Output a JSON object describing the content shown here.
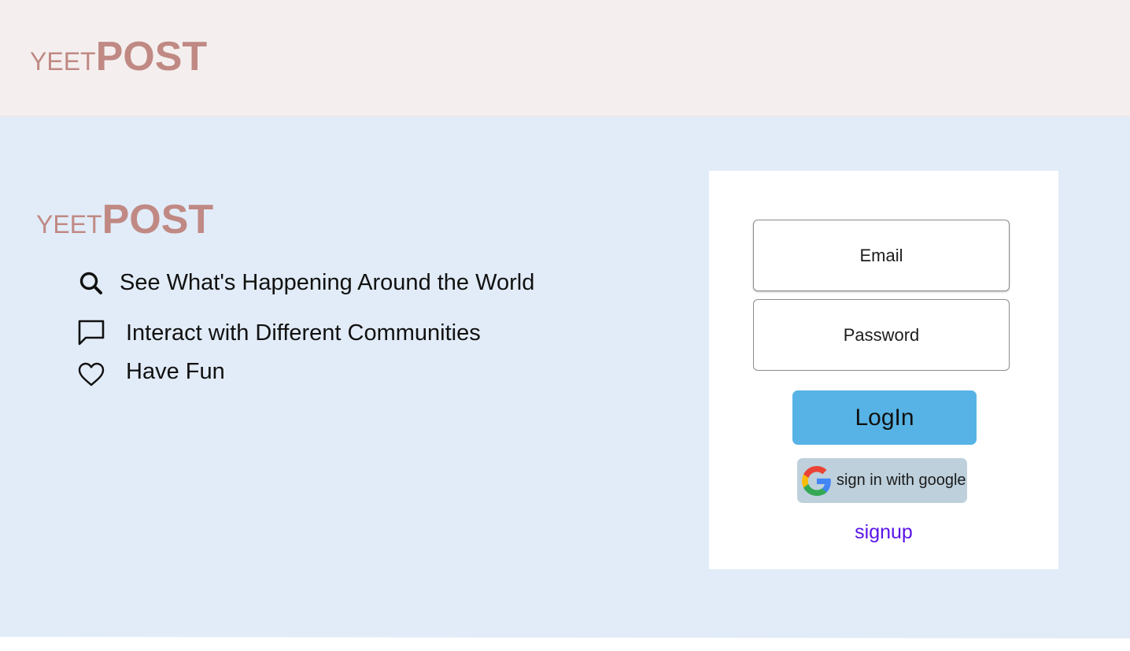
{
  "header": {
    "logo_small": "YEET",
    "logo_big": "POST"
  },
  "hero": {
    "logo_small": "YEET",
    "logo_big": "POST",
    "features": [
      {
        "icon": "search-icon",
        "text": "See What's Happening Around the World"
      },
      {
        "icon": "chat-bubble-icon",
        "text": "Interact with Different Communities"
      },
      {
        "icon": "heart-icon",
        "text": "Have Fun"
      }
    ]
  },
  "login": {
    "email_placeholder": "Email",
    "password_placeholder": "Password",
    "login_label": "LogIn",
    "google_label": "sign in with google",
    "signup_label": "signup"
  },
  "colors": {
    "header_bg": "#f4efee",
    "hero_bg": "#e2ecf8",
    "logo": "#c08984",
    "login_button": "#57b3e5",
    "google_button": "#bdd0dc",
    "signup_link": "#5a13e8"
  }
}
